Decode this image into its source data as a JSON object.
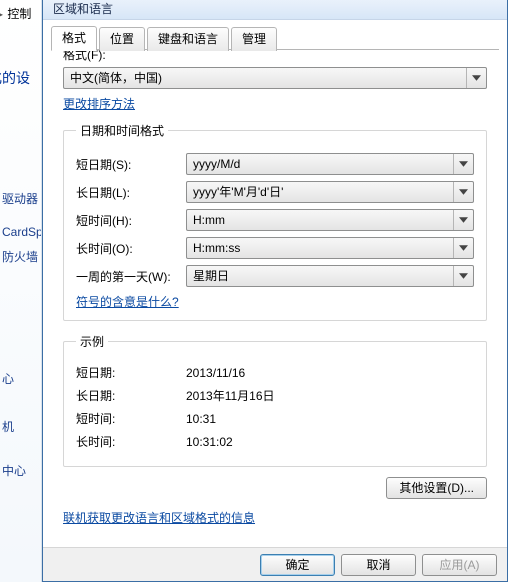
{
  "leftpane": {
    "breadcrumb_prefix": "控制",
    "heading_suffix": "化的设",
    "sidebar_items": [
      "驱动器",
      "CardSp",
      "防火墙",
      "心",
      "机",
      "中心"
    ]
  },
  "dialog": {
    "title": "区域和语言",
    "tabs": {
      "format": "格式",
      "location": "位置",
      "keyboard": "键盘和语言",
      "admin": "管理"
    },
    "format_label": "格式(F):",
    "format_value": "中文(简体，中国)",
    "change_sort_link": "更改排序方法",
    "group_formats_title": "日期和时间格式",
    "rows": {
      "short_date": {
        "label": "短日期(S):",
        "value": "yyyy/M/d"
      },
      "long_date": {
        "label": "长日期(L):",
        "value": "yyyy'年'M'月'd'日'"
      },
      "short_time": {
        "label": "短时间(H):",
        "value": "H:mm"
      },
      "long_time": {
        "label": "长时间(O):",
        "value": "H:mm:ss"
      },
      "first_day": {
        "label": "一周的第一天(W):",
        "value": "星期日"
      }
    },
    "symbols_link": "符号的含意是什么?",
    "group_example_title": "示例",
    "example": {
      "short_date": {
        "label": "短日期:",
        "value": "2013/11/16"
      },
      "long_date": {
        "label": "长日期:",
        "value": "2013年11月16日"
      },
      "short_time": {
        "label": "短时间:",
        "value": "10:31"
      },
      "long_time": {
        "label": "长时间:",
        "value": "10:31:02"
      }
    },
    "additional_settings_btn": "其他设置(D)...",
    "online_link": "联机获取更改语言和区域格式的信息",
    "ok_btn": "确定",
    "cancel_btn": "取消",
    "apply_btn": "应用(A)"
  }
}
